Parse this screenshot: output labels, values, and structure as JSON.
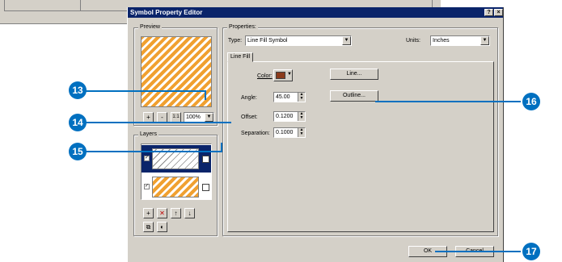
{
  "dialog": {
    "title": "Symbol Property Editor",
    "help_label": "?",
    "close_label": "×"
  },
  "preview": {
    "group_label": "Preview",
    "zoom_in_label": "+",
    "zoom_out_label": "-",
    "actual_size_label": "1:1",
    "zoom_value": "100%"
  },
  "layers": {
    "group_label": "Layers",
    "add_label": "+",
    "delete_label": "✕",
    "move_up_label": "↑",
    "move_down_label": "↓",
    "copy_label": "⧉",
    "paste_label": "◐"
  },
  "properties": {
    "group_label": "Properties:",
    "type_label": "Type:",
    "type_value": "Line Fill Symbol",
    "units_label": "Units:",
    "units_value": "Inches",
    "tab_label": "Line Fill",
    "color_label": "Color:",
    "color_value": "#8b3a1a",
    "angle_label": "Angle:",
    "angle_value": "45.00",
    "offset_label": "Offset:",
    "offset_value": "0.1200",
    "separation_label": "Separation:",
    "separation_value": "0.1000",
    "line_button": "Line...",
    "outline_button": "Outline..."
  },
  "footer": {
    "ok_label": "OK",
    "cancel_label": "Cancel"
  },
  "callouts": {
    "c13": "13",
    "c14": "14",
    "c15": "15",
    "c16": "16",
    "c17": "17"
  },
  "colors": {
    "accent": "#0070c0",
    "title_bar": "#0a246a",
    "hatch_orange": "#f0a030"
  }
}
